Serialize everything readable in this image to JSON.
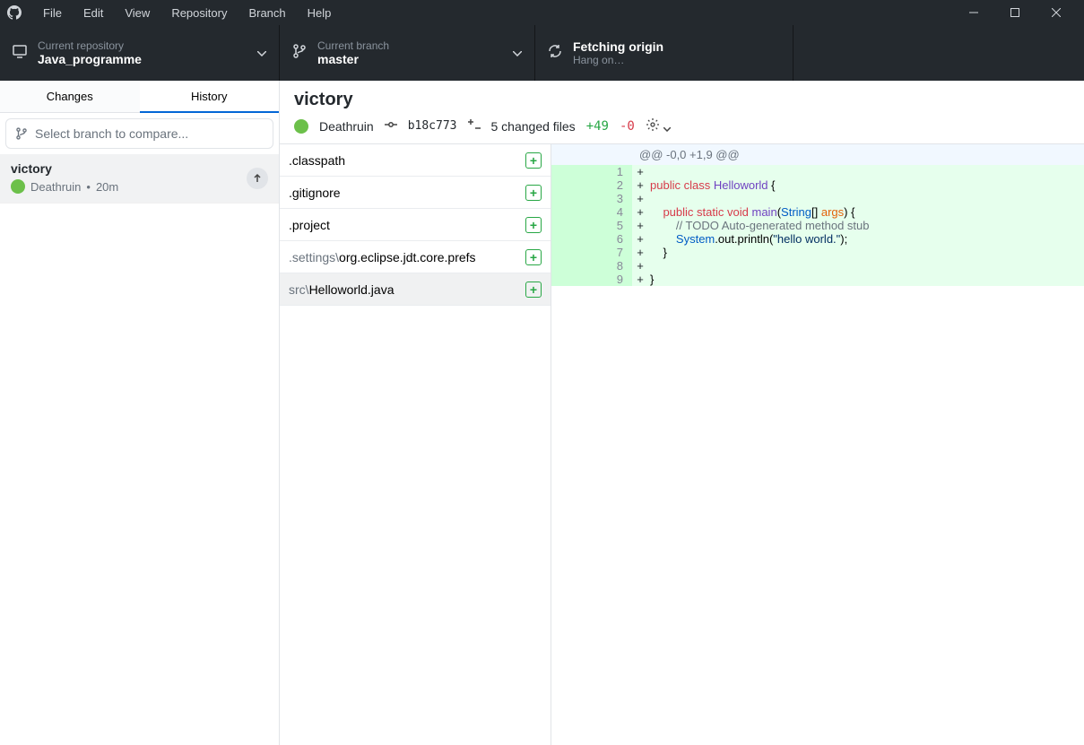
{
  "menu": {
    "file": "File",
    "edit": "Edit",
    "view": "View",
    "repository": "Repository",
    "branch": "Branch",
    "help": "Help"
  },
  "toolbar": {
    "repo_label": "Current repository",
    "repo_value": "Java_programme",
    "branch_label": "Current branch",
    "branch_value": "master",
    "sync_title": "Fetching origin",
    "sync_sub": "Hang on…"
  },
  "tabs": {
    "changes": "Changes",
    "history": "History"
  },
  "branch_compare_placeholder": "Select branch to compare...",
  "commit_list": {
    "title": "victory",
    "author": "Deathruin",
    "age": "20m"
  },
  "commit_header": {
    "title": "victory",
    "author": "Deathruin",
    "sha": "b18c773",
    "changed_files": "5 changed files",
    "additions": "+49",
    "deletions": "-0"
  },
  "files": [
    {
      "name": ".classpath",
      "dim": "",
      "selected": false
    },
    {
      "name": ".gitignore",
      "dim": "",
      "selected": false
    },
    {
      "name": ".project",
      "dim": "",
      "selected": false
    },
    {
      "name": "org.eclipse.jdt.core.prefs",
      "dim": ".settings\\",
      "selected": false
    },
    {
      "name": "Helloworld.java",
      "dim": "src\\",
      "selected": true
    }
  ],
  "diff": {
    "hunk": "@@ -0,0 +1,9 @@",
    "lines": [
      {
        "n": 1,
        "tokens": []
      },
      {
        "n": 2,
        "tokens": [
          [
            "kw-red",
            "public"
          ],
          [
            "",
            " "
          ],
          [
            "kw-red",
            "class"
          ],
          [
            "",
            " "
          ],
          [
            "kw-purple",
            "Helloworld"
          ],
          [
            "",
            " {"
          ]
        ]
      },
      {
        "n": 3,
        "tokens": []
      },
      {
        "n": 4,
        "tokens": [
          [
            "",
            "    "
          ],
          [
            "kw-red",
            "public"
          ],
          [
            "",
            " "
          ],
          [
            "kw-red",
            "static"
          ],
          [
            "",
            " "
          ],
          [
            "kw-red",
            "void"
          ],
          [
            "",
            " "
          ],
          [
            "kw-purple",
            "main"
          ],
          [
            "",
            "("
          ],
          [
            "kw-blue",
            "String"
          ],
          [
            "",
            "[] "
          ],
          [
            "kw-orange",
            "args"
          ],
          [
            "",
            ") {"
          ]
        ]
      },
      {
        "n": 5,
        "tokens": [
          [
            "",
            "        "
          ],
          [
            "kw-gray",
            "// TODO Auto-generated method stub"
          ]
        ]
      },
      {
        "n": 6,
        "tokens": [
          [
            "",
            "        "
          ],
          [
            "kw-blue",
            "System"
          ],
          [
            "",
            ".out.println("
          ],
          [
            "kw-navy",
            "\"hello world.\""
          ],
          [
            "",
            ");"
          ]
        ]
      },
      {
        "n": 7,
        "tokens": [
          [
            "",
            "    }"
          ]
        ]
      },
      {
        "n": 8,
        "tokens": []
      },
      {
        "n": 9,
        "tokens": [
          [
            "",
            "}"
          ]
        ]
      }
    ]
  }
}
